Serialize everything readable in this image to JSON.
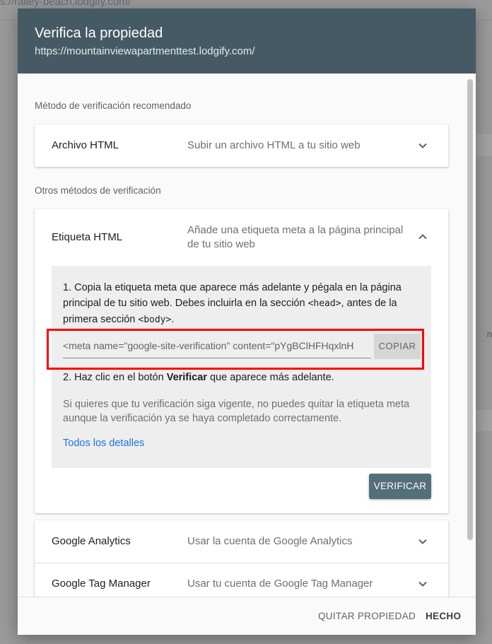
{
  "background": {
    "url_text": "s://railey-beach.lodgify.com/\"",
    "right_text": "n"
  },
  "dialog": {
    "title": "Verifica la propiedad",
    "subtitle": "https://mountainviewapartmenttest.lodgify.com/"
  },
  "recommended": {
    "label": "Método de verificación recomendado",
    "items": [
      {
        "title": "Archivo HTML",
        "desc": "Subir un archivo HTML a tu sitio web"
      }
    ]
  },
  "other": {
    "label": "Otros métodos de verificación",
    "html_tag": {
      "title": "Etiqueta HTML",
      "desc": "Añade una etiqueta meta a la página principal de tu sitio web",
      "step1_a": "1. Copia la etiqueta meta que aparece más adelante y pégala en la página principal de tu sitio web. Debes incluirla en la sección ",
      "step1_head": "<head>",
      "step1_b": ", antes de la primera sección ",
      "step1_body": "<body>",
      "step1_c": ".",
      "meta_value": "<meta name=\"google-site-verification\" content=\"pYgBClHFHqxlnH",
      "copy_label": "COPIAR",
      "step2_a": "2. Haz clic en el botón ",
      "step2_bold": "Verificar",
      "step2_b": " que aparece más adelante.",
      "note": "Si quieres que tu verificación siga vigente, no puedes quitar la etiqueta meta aunque la verificación ya se haya completado correctamente.",
      "details_link": "Todos los detalles",
      "verify_label": "VERIFICAR"
    },
    "items": [
      {
        "title": "Google Analytics",
        "desc": "Usar la cuenta de Google Analytics"
      },
      {
        "title": "Google Tag Manager",
        "desc": "Usar tu cuenta de Google Tag Manager"
      }
    ]
  },
  "footer": {
    "remove_label": "QUITAR PROPIEDAD",
    "done_label": "HECHO"
  },
  "colors": {
    "header": "#455a64",
    "verify_button": "#546e7a",
    "link": "#1a73e8",
    "highlight": "#ff0000"
  },
  "icons": [
    "chevron-down-icon",
    "chevron-up-icon"
  ]
}
